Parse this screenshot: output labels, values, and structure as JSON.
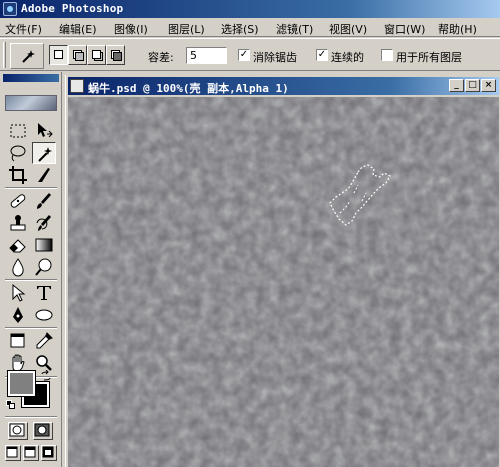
{
  "app": {
    "title": "Adobe Photoshop"
  },
  "menu": [
    {
      "label": "文件(F)"
    },
    {
      "label": "编辑(E)"
    },
    {
      "label": "图像(I)"
    },
    {
      "label": "图层(L)"
    },
    {
      "label": "选择(S)"
    },
    {
      "label": "滤镜(T)"
    },
    {
      "label": "视图(V)"
    },
    {
      "label": "窗口(W)"
    },
    {
      "label": "帮助(H)"
    }
  ],
  "options": {
    "tolerance_label": "容差:",
    "tolerance_value": "5",
    "antialias": {
      "label": "消除锯齿",
      "checked": true
    },
    "contiguous": {
      "label": "连续的",
      "checked": true
    },
    "all_layers": {
      "label": "用于所有图层",
      "checked": false
    }
  },
  "toolbox": {
    "foreground_color": "#808080",
    "background_color": "#000000",
    "active_tool": "magic-wand"
  },
  "document": {
    "title": "蜗牛.psd @ 100%(壳 副本,Alpha 1)",
    "canvas_color": "#6e6c72"
  }
}
